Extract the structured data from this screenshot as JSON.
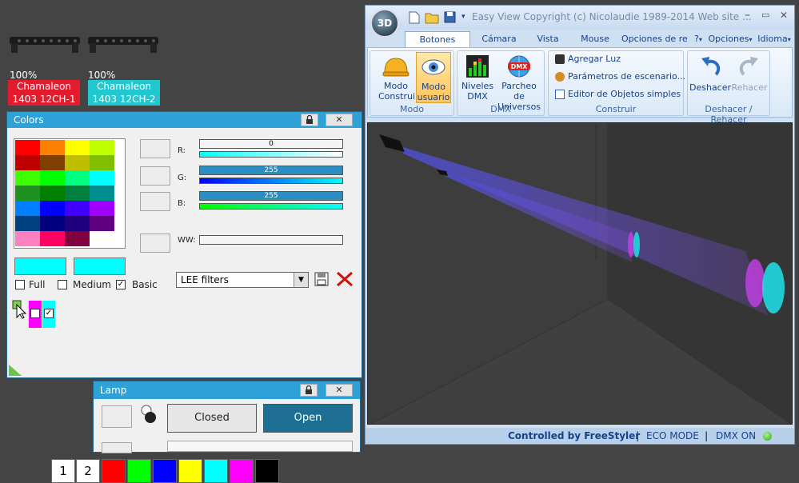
{
  "fixtures": [
    {
      "percent": "100%",
      "name_line1": "Chamaleon",
      "name_line2": "1403 12CH-1",
      "color": "#e21c2c"
    },
    {
      "percent": "100%",
      "name_line1": "Chamaleon",
      "name_line2": "1403 12CH-2",
      "color": "#22c8d0"
    }
  ],
  "colors_window": {
    "title": "Colors",
    "palette": [
      "#ff0000",
      "#ff7f00",
      "#ffff00",
      "#bfff00",
      "#bf0000",
      "#7f3f00",
      "#bfbf00",
      "#7fbf00",
      "#40ff00",
      "#00ff00",
      "#00ff7f",
      "#00ffff",
      "#1f8f1f",
      "#007f00",
      "#007f3f",
      "#008f8f",
      "#0080ff",
      "#0000ff",
      "#4000ff",
      "#a000ff",
      "#004080",
      "#00007f",
      "#20007f",
      "#600080",
      "#ff80c0",
      "#ff0060",
      "#800040",
      "#ffffff"
    ],
    "r_label": "R:",
    "r_value": "0",
    "g_label": "G:",
    "g_value": "255",
    "b_label": "B:",
    "b_value": "255",
    "ww_label": "WW:",
    "check_full": "Full",
    "check_medium": "Medium",
    "check_basic": "Basic",
    "filter_select": "LEE filters",
    "preset_1": "1",
    "preset_2": "2",
    "bottom_swatches": [
      "#ff0000",
      "#00ff00",
      "#0000ff",
      "#ffff00",
      "#00ffff",
      "#ff00ff",
      "#000000"
    ],
    "current_color": "#00ffff"
  },
  "lamp_window": {
    "title": "Lamp",
    "closed_label": "Closed",
    "open_label": "Open"
  },
  "app": {
    "title": "Easy View  Copyright (c) Nicolaudie 1989-2014  Web site ...",
    "logo": "3D",
    "tabs": [
      "Botones estánc",
      "Cámara",
      "Vista",
      "Mouse",
      "Opciones de re"
    ],
    "right_menus": [
      "?",
      "Opciones",
      "Idioma"
    ],
    "modo_construir": "Modo Construir",
    "modo_usuario": "Modo usuario",
    "niveles_dmx": "Niveles DMX",
    "parcheo": "Parcheo de Universos",
    "dmx_badge": "DMX",
    "agregar_luz": "Agregar Luz",
    "parametros": "Parámetros de escenario...",
    "editor": "Editor de Objetos simples",
    "deshacer": "Deshacer",
    "rehacer": "Rehacer",
    "group_modo": "Modo",
    "group_dmx": "DMX",
    "group_construir": "Construir",
    "group_undo": "Deshacer / Rehacer",
    "status_controlled": "Controlled by FreeStyler",
    "status_eco": "ECO MODE",
    "status_dmx": "DMX ON",
    "sep": "|"
  }
}
